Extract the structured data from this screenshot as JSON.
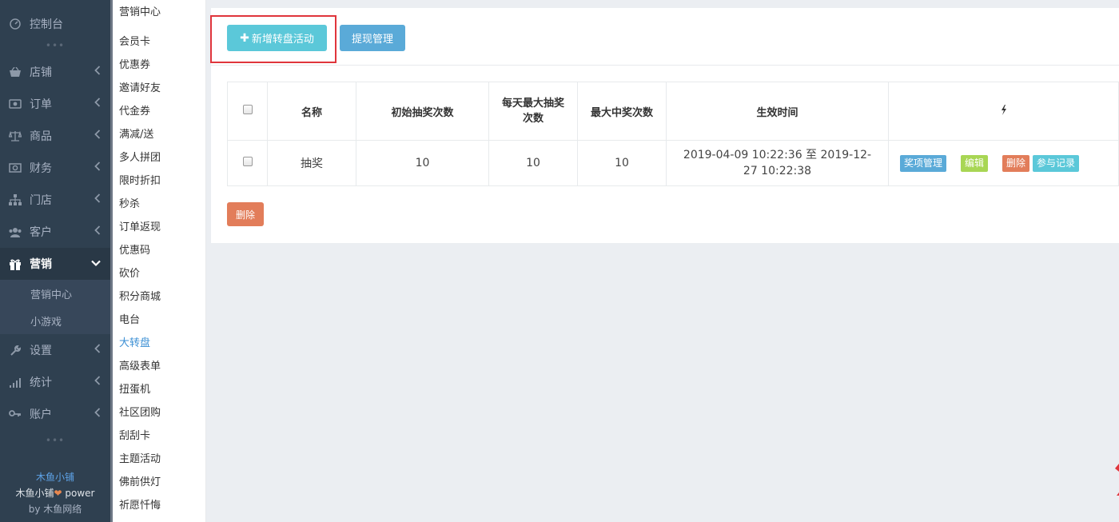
{
  "sidebar": {
    "console": "控制台",
    "dots": "•••",
    "items": [
      {
        "label": "店铺",
        "icon": "basket-icon"
      },
      {
        "label": "订单",
        "icon": "money-icon"
      },
      {
        "label": "商品",
        "icon": "scale-icon"
      },
      {
        "label": "财务",
        "icon": "cash-icon"
      },
      {
        "label": "门店",
        "icon": "sitemap-icon"
      },
      {
        "label": "客户",
        "icon": "users-icon"
      }
    ],
    "active": {
      "label": "营销",
      "icon": "gift-icon"
    },
    "subitems": [
      "营销中心",
      "小游戏"
    ],
    "items_after": [
      {
        "label": "设置",
        "icon": "wrench-icon"
      },
      {
        "label": "统计",
        "icon": "signal-icon"
      },
      {
        "label": "账户",
        "icon": "key-icon"
      }
    ],
    "footer": {
      "brand": "木鱼小铺",
      "power_prefix": "木鱼小铺",
      "power_suffix": " power",
      "by_prefix": "by ",
      "by_name": "木鱼网络"
    }
  },
  "submenu": {
    "items": [
      "营销中心",
      "会员卡",
      "优惠券",
      "邀请好友",
      "代金券",
      "满减/送",
      "多人拼团",
      "限时折扣",
      "秒杀",
      "订单返现",
      "优惠码",
      "砍价",
      "积分商城",
      "电台",
      "大转盘",
      "高级表单",
      "扭蛋机",
      "社区团购",
      "刮刮卡",
      "主题活动",
      "佛前供灯",
      "祈愿忏悔"
    ],
    "active_index": 14
  },
  "toolbar": {
    "add_label": "新增转盘活动",
    "withdraw_label": "提现管理"
  },
  "table": {
    "headers": {
      "name": "名称",
      "initial": "初始抽奖次数",
      "daily": "每天最大抽奖次数",
      "max_win": "最大中奖次数",
      "time": "生效时间",
      "actions_icon": "bolt-icon"
    },
    "rows": [
      {
        "name": "抽奖",
        "initial": "10",
        "daily": "10",
        "max_win": "10",
        "time": "2019-04-09 10:22:36 至 2019-12-27 10:22:38",
        "actions": {
          "prize": "奖项管理",
          "edit": "编辑",
          "delete": "删除",
          "records": "参与记录"
        }
      }
    ]
  },
  "delete_label": "删除",
  "colors": {
    "sidebar_bg": "#2f4050",
    "add_button": "#5bc8d9",
    "withdraw_button": "#5aaad8",
    "edit_button": "#a8d654",
    "delete_button": "#e27d5a",
    "highlight_box": "#e0353c",
    "active_submenu": "#3b8fd4"
  }
}
